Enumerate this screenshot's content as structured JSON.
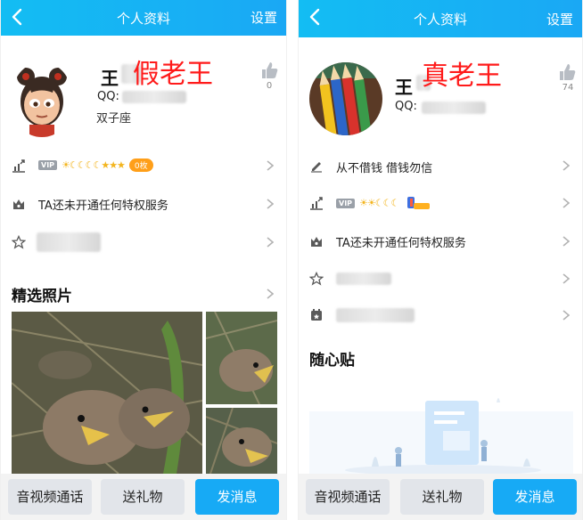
{
  "left": {
    "header": {
      "title": "个人资料",
      "settings": "设置"
    },
    "profile": {
      "name": "王",
      "overlay": "假老王",
      "qq_label": "QQ:",
      "zodiac": "双子座",
      "like_count": "0"
    },
    "rows": [
      {
        "icon": "rank-icon",
        "vip_badge": "VIP",
        "level_glyphs": "☀☾☾☾☾★★★",
        "coin_text": "0枚"
      },
      {
        "icon": "crown-icon",
        "label": "TA还未开通任何特权服务"
      },
      {
        "icon": "star-icon",
        "label": ""
      }
    ],
    "photos": {
      "title": "精选照片"
    },
    "actions": {
      "call": "音视频通话",
      "gift": "送礼物",
      "message": "发消息"
    }
  },
  "right": {
    "header": {
      "title": "个人资料",
      "settings": "设置"
    },
    "profile": {
      "name": "王",
      "overlay": "真老王",
      "qq_label": "QQ:",
      "like_count": "74"
    },
    "rows": [
      {
        "icon": "edit-icon",
        "label": "从不借钱 借钱勿信"
      },
      {
        "icon": "rank-icon",
        "vip_badge": "VIP",
        "level_glyphs": "☀☀☾☾☾"
      },
      {
        "icon": "crown-icon",
        "label": "TA还未开通任何特权服务"
      },
      {
        "icon": "star-icon",
        "label": ""
      },
      {
        "icon": "calendar-icon",
        "label": ""
      }
    ],
    "notes": {
      "title": "随心贴"
    },
    "actions": {
      "call": "音视频通话",
      "gift": "送礼物",
      "message": "发消息"
    }
  },
  "colors": {
    "topbar": "#13bdf3",
    "primary_button": "#17aaf5",
    "overlay_text": "#ff1a1a",
    "level_gold": "#f3b51f",
    "coin": "#ff9f19"
  }
}
